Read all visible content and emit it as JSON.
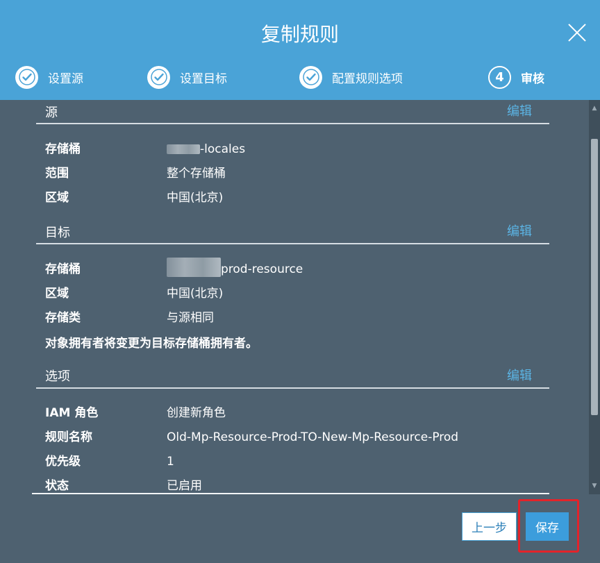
{
  "dialog": {
    "title": "复制规则"
  },
  "steps": [
    {
      "label": "设置源",
      "status": "done",
      "icon": "check-icon"
    },
    {
      "label": "设置目标",
      "status": "done",
      "icon": "check-icon"
    },
    {
      "label": "配置规则选项",
      "status": "done",
      "icon": "check-icon"
    },
    {
      "number": "4",
      "label": "审核",
      "status": "current"
    }
  ],
  "source": {
    "heading": "源",
    "edit_label": "编辑",
    "rows": [
      {
        "key": "存储桶",
        "value": "-locales"
      },
      {
        "key": "范围",
        "value": "整个存储桶"
      },
      {
        "key": "区域",
        "value": "中国(北京)"
      }
    ]
  },
  "target": {
    "heading": "目标",
    "edit_label": "编辑",
    "rows": [
      {
        "key": "存储桶",
        "value": "prod-resource"
      },
      {
        "key": "区域",
        "value": "中国(北京)"
      },
      {
        "key": "存储类",
        "value": "与源相同"
      }
    ],
    "notice": "对象拥有者将变更为目标存储桶拥有者。"
  },
  "options": {
    "heading": "选项",
    "edit_label": "编辑",
    "rows": [
      {
        "key": "IAM 角色",
        "value": "创建新角色"
      },
      {
        "key": "规则名称",
        "value": "Old-Mp-Resource-Prod-TO-New-Mp-Resource-Prod"
      },
      {
        "key": "优先级",
        "value": "1"
      },
      {
        "key": "状态",
        "value": "已启用"
      }
    ]
  },
  "footer": {
    "prev_label": "上一步",
    "save_label": "保存"
  },
  "colors": {
    "header": "#4aa3d7",
    "body": "#4e6170",
    "link": "#5bb4e4",
    "highlight": "#e3232a"
  }
}
